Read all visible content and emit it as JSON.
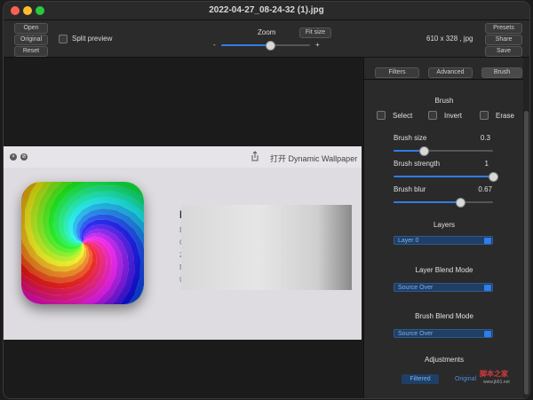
{
  "window": {
    "title": "2022-04-27_08-24-32 (1).jpg"
  },
  "toolbar": {
    "open": "Open",
    "original": "Original",
    "reset": "Reset",
    "split_preview": "Split preview",
    "zoom_label": "Zoom",
    "fit_size": "Fit size",
    "zoom_minus": "-",
    "zoom_plus": "+",
    "zoom_level": 0.55,
    "dimensions": "610 x 328 , jpg",
    "presets": "Presets",
    "share": "Share",
    "save": "Save"
  },
  "preview": {
    "open_with": "打开 Dynamic Wallpaper",
    "side_chars": [
      "I",
      "E",
      "C",
      "2",
      "B",
      "U"
    ]
  },
  "panel": {
    "tabs": {
      "filters": "Filters",
      "advanced": "Advanced",
      "brush": "Brush"
    },
    "brush": {
      "title": "Brush",
      "select": "Select",
      "invert": "Invert",
      "erase": "Erase",
      "size_label": "Brush size",
      "size_value": "0.3",
      "size_level": 0.3,
      "strength_label": "Brush strength",
      "strength_value": "1",
      "strength_level": 1,
      "blur_label": "Brush blur",
      "blur_value": "0.67",
      "blur_level": 0.67
    },
    "layers": {
      "title": "Layers",
      "selected": "Layer 0"
    },
    "layer_blend": {
      "title": "Layer Blend Mode",
      "selected": "Source Over"
    },
    "brush_blend": {
      "title": "Brush Blend Mode",
      "selected": "Source Over"
    },
    "adjustments": {
      "title": "Adjustments",
      "filtered": "Filtered",
      "original": "Original"
    }
  },
  "watermark": {
    "text": "脚本之家",
    "sub": "www.jb51.net"
  },
  "colors": {
    "accent": "#2f7de8",
    "select_bg": "#1f3f66",
    "close": "#fe5f57",
    "minimize": "#febc2e",
    "maximize": "#28c840"
  }
}
